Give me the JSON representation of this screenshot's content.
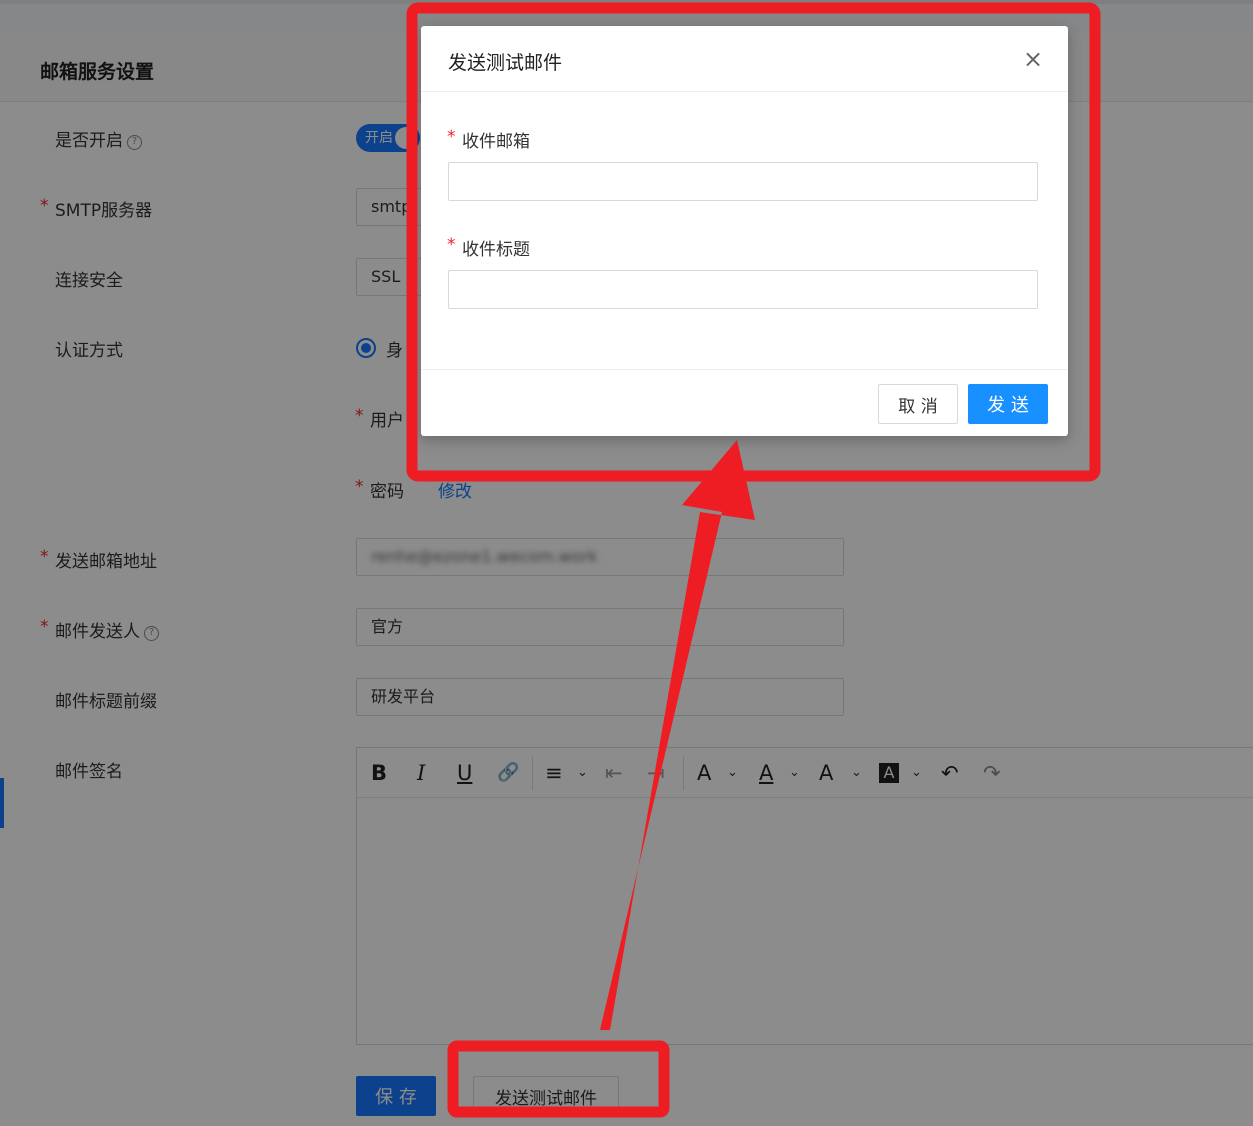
{
  "settings": {
    "title": "邮箱服务设置",
    "fields": {
      "enabled": {
        "label": "是否开启",
        "switch_text": "开启"
      },
      "smtp_server": {
        "label": "SMTP服务器",
        "value": "smtp"
      },
      "security": {
        "label": "连接安全",
        "value": "SSL"
      },
      "auth": {
        "label": "认证方式",
        "option": "身",
        "username_label": "用户",
        "password_label": "密码",
        "password_link": "修改"
      },
      "sender_address": {
        "label": "发送邮箱地址",
        "value": "renhe@ezone1.wecom.work"
      },
      "sender_name": {
        "label": "邮件发送人",
        "value": "官方"
      },
      "subject_prefix": {
        "label": "邮件标题前缀",
        "value": "研发平台"
      },
      "signature": {
        "label": "邮件签名"
      }
    },
    "editor_toolbar": {
      "bold": "B",
      "italic": "I",
      "underline": "U",
      "link": "🔗",
      "align": "≡",
      "outdent": "⇤",
      "indent": "⇥",
      "font_size": "A",
      "font_color": "A",
      "line_height": "A",
      "bg_color": "A",
      "undo": "↶",
      "redo": "↷",
      "caret": "⌄"
    },
    "save_label": "保 存",
    "test_mail_label": "发送测试邮件"
  },
  "modal": {
    "title": "发送测试邮件",
    "close_icon": "×",
    "recipient_label": "收件邮箱",
    "recipient_value": "",
    "subject_label": "收件标题",
    "subject_value": "",
    "cancel_label": "取 消",
    "send_label": "发 送"
  },
  "colors": {
    "primary": "#1677ff",
    "required": "#f5222d",
    "annotation": "#ee1d24",
    "overlay": "rgba(0,0,0,0.45)"
  }
}
